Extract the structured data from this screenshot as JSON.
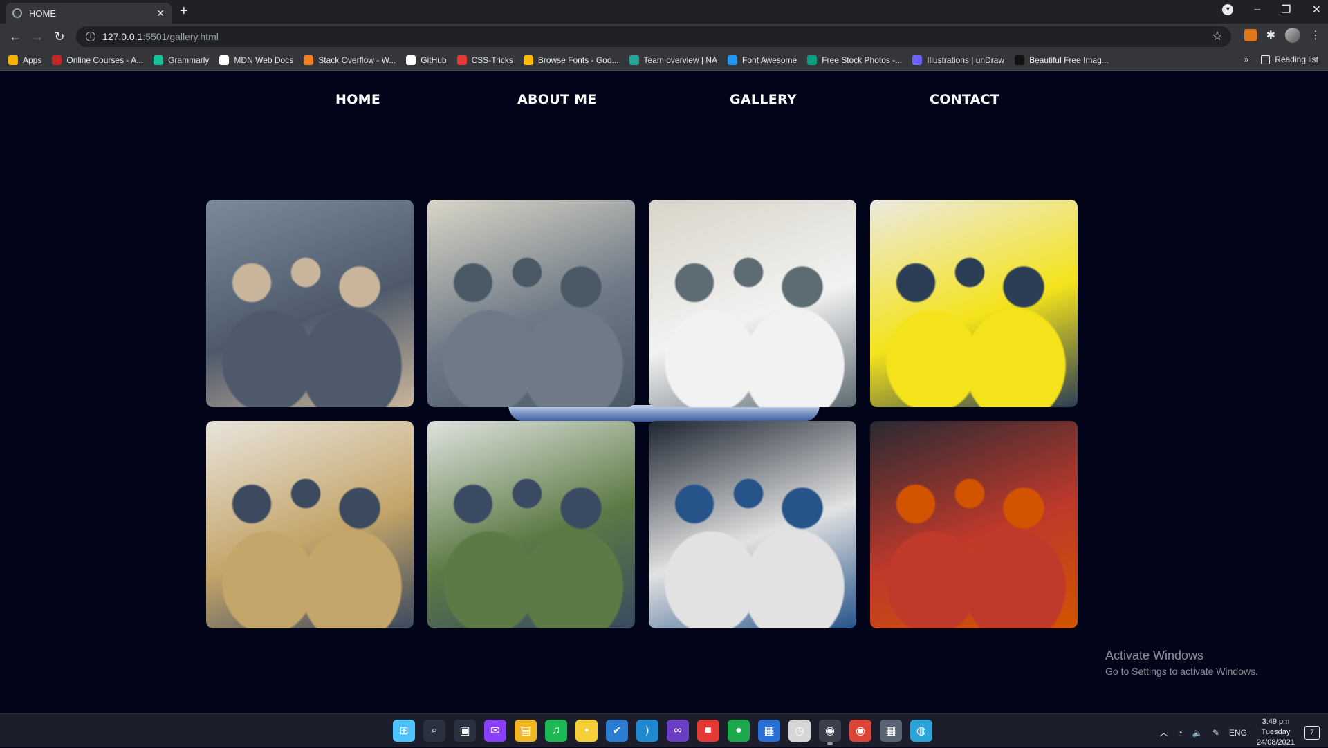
{
  "browser": {
    "tab_title": "HOME",
    "new_tab": "+",
    "url_host": "127.0.0.1",
    "url_path": ":5501/gallery.html",
    "bookmarks": [
      {
        "label": "Apps",
        "color": "#f4b400"
      },
      {
        "label": "Online Courses - A...",
        "color": "#c62828"
      },
      {
        "label": "Grammarly",
        "color": "#15c39a"
      },
      {
        "label": "MDN Web Docs",
        "color": "#ffffff"
      },
      {
        "label": "Stack Overflow - W...",
        "color": "#f48024"
      },
      {
        "label": "GitHub",
        "color": "#ffffff"
      },
      {
        "label": "CSS-Tricks",
        "color": "#e53935"
      },
      {
        "label": "Browse Fonts - Goo...",
        "color": "#fbbc04"
      },
      {
        "label": "Team overview | NA",
        "color": "#26a69a"
      },
      {
        "label": "Font Awesome",
        "color": "#2196f3"
      },
      {
        "label": "Free Stock Photos -...",
        "color": "#05a081"
      },
      {
        "label": "Illustrations | unDraw",
        "color": "#6c63ff"
      },
      {
        "label": "Beautiful Free Imag...",
        "color": "#111111"
      }
    ],
    "more_bookmarks": "»",
    "reading_list": "Reading list"
  },
  "site_nav": {
    "home": "HOME",
    "about": "ABOUT ME",
    "gallery": "GALLERY",
    "contact": "CONTACT"
  },
  "gallery": {
    "photos": [
      {
        "name": "photo-group-selfie-classroom",
        "palette": [
          "#7b8a9a",
          "#4e5a6b",
          "#c9b59c"
        ]
      },
      {
        "name": "photo-crowd-hall",
        "palette": [
          "#d9d6c8",
          "#6f7a86",
          "#4b5966"
        ]
      },
      {
        "name": "photo-participant-ids",
        "palette": [
          "#d8d4c8",
          "#f2f2f2",
          "#5d6b72"
        ]
      },
      {
        "name": "photo-beanbag-nap",
        "palette": [
          "#ece9e2",
          "#f4e31b",
          "#2c3e55"
        ]
      },
      {
        "name": "photo-mall-group",
        "palette": [
          "#e8e4dc",
          "#c4a56a",
          "#3b4a5e"
        ]
      },
      {
        "name": "photo-park-tent",
        "palette": [
          "#dfe3df",
          "#5c7a45",
          "#3a4a62"
        ]
      },
      {
        "name": "photo-night-court",
        "palette": [
          "#1c2430",
          "#e2e2e2",
          "#26548a"
        ]
      },
      {
        "name": "photo-party-friends",
        "palette": [
          "#2a2a33",
          "#c0392b",
          "#d35400"
        ]
      }
    ]
  },
  "watermark": {
    "title": "Activate Windows",
    "subtitle": "Go to Settings to activate Windows."
  },
  "taskbar": {
    "apps": [
      {
        "name": "start",
        "color": "#4cc2ff",
        "glyph": "⊞"
      },
      {
        "name": "search",
        "color": "#2c3140",
        "glyph": "⌕"
      },
      {
        "name": "task-view",
        "color": "#2c3140",
        "glyph": "▣"
      },
      {
        "name": "messenger",
        "color": "#8a3ffc",
        "glyph": "✉"
      },
      {
        "name": "file-explorer",
        "color": "#f2b824",
        "glyph": "▤"
      },
      {
        "name": "spotify",
        "color": "#1db954",
        "glyph": "♫"
      },
      {
        "name": "sticky-notes",
        "color": "#f7d038",
        "glyph": "▪"
      },
      {
        "name": "todo",
        "color": "#2b7cd3",
        "glyph": "✔"
      },
      {
        "name": "vscode",
        "color": "#1f8ad2",
        "glyph": "⟩"
      },
      {
        "name": "visual-studio",
        "color": "#6a3fc4",
        "glyph": "∞"
      },
      {
        "name": "figma-like",
        "color": "#e53935",
        "glyph": "■"
      },
      {
        "name": "line-app",
        "color": "#1ba94c",
        "glyph": "●"
      },
      {
        "name": "calendar",
        "color": "#2a6fd6",
        "glyph": "▦"
      },
      {
        "name": "clock-app",
        "color": "#d6d6d6",
        "glyph": "◷"
      },
      {
        "name": "chrome-dev",
        "color": "#3b3f4a",
        "glyph": "◉"
      },
      {
        "name": "chrome",
        "color": "#db4437",
        "glyph": "◉"
      },
      {
        "name": "calculator",
        "color": "#5b6475",
        "glyph": "▦"
      },
      {
        "name": "network-globe",
        "color": "#2aa3d8",
        "glyph": "◍"
      }
    ],
    "lang": "ENG",
    "time": "3:49 pm",
    "day": "Tuesday",
    "date": "24/08/2021",
    "notifications": "7"
  }
}
